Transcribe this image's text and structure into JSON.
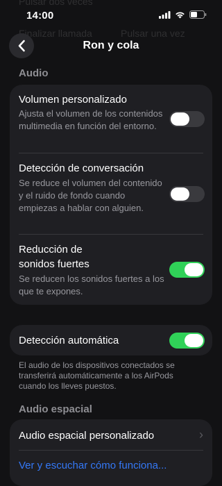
{
  "status_bar": {
    "time": "14:00"
  },
  "background_rows": {
    "row1": "Pulsar dos veces",
    "row2_label": "Finalizar llamada",
    "row2_value": "Pulsar una vez"
  },
  "nav": {
    "title": "Ron y cola"
  },
  "audio_section": {
    "header": "Audio",
    "items": [
      {
        "title": "Volumen personalizado",
        "description": "Ajusta el volumen de los contenidos multimedia en función del entorno.",
        "enabled": false
      },
      {
        "title": "Detección de conversación",
        "description": "Se reduce el volumen del contenido y el ruido de fondo cuando empiezas a hablar con alguien.",
        "enabled": false
      },
      {
        "title_line1": "Reducción de",
        "title_line2": "sonidos fuertes",
        "description": "Se reducen los sonidos fuertes a los que te expones.",
        "enabled": true
      }
    ]
  },
  "auto_detect": {
    "title": "Detección automática",
    "enabled": true,
    "footer": "El audio de los dispositivos conectados se transferirá automáticamente a los AirPods cuando los lleves puestos."
  },
  "spatial_section": {
    "header": "Audio espacial",
    "item_label": "Audio espacial personalizado",
    "link_label": "Ver y escuchar cómo funciona..."
  },
  "colors": {
    "toggle_on": "#30d158",
    "link": "#3478f6",
    "card": "#1f1f23"
  }
}
